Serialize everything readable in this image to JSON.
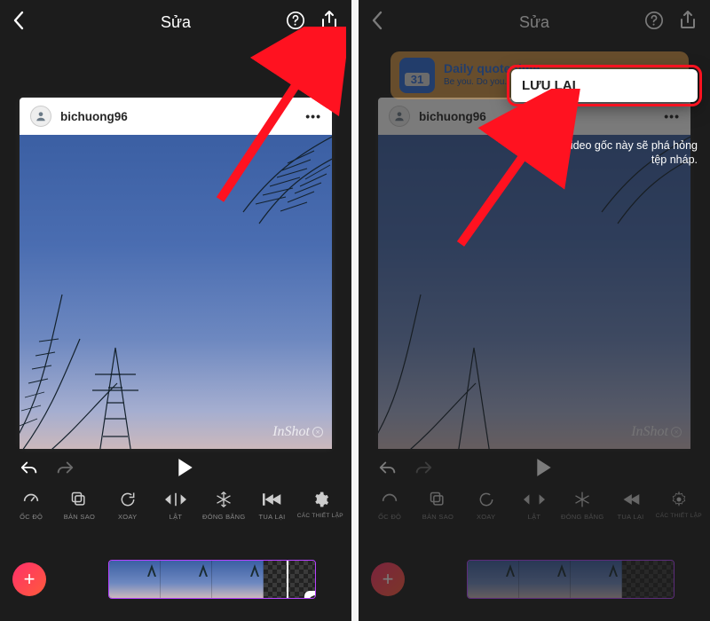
{
  "header": {
    "title": "Sửa"
  },
  "post": {
    "username": "bichuong96",
    "more": "•••"
  },
  "watermark": "InShot",
  "toolbar": {
    "items": [
      {
        "label": "ỐC ĐỘ"
      },
      {
        "label": "BẢN SAO"
      },
      {
        "label": "XOAY"
      },
      {
        "label": "LẬT"
      },
      {
        "label": "ĐÓNG BĂNG"
      },
      {
        "label": "TUA LẠI"
      },
      {
        "label": "CÁC THIẾT LẬP"
      }
    ]
  },
  "popup": {
    "save_label": "LƯU LẠI"
  },
  "hint": "Việc xóa video gốc này sẽ phá hỏng tệp nháp.",
  "banner": {
    "day": "31",
    "line1": "Daily quote time",
    "line2": "Be you. Do you."
  }
}
